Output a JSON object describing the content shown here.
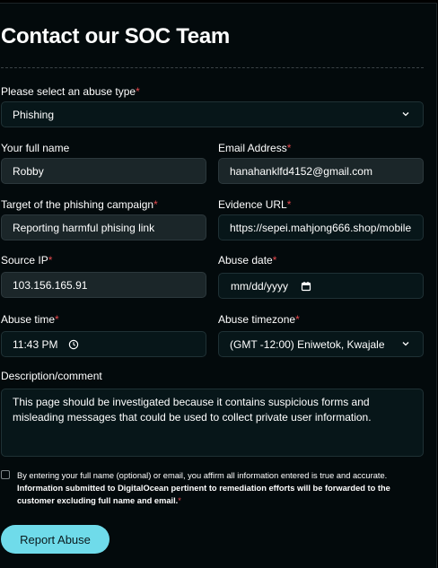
{
  "header": {
    "title": "Contact our SOC Team"
  },
  "form": {
    "abuse_type": {
      "label": "Please select an abuse type",
      "required_mark": "*",
      "value": "Phishing"
    },
    "full_name": {
      "label": "Your full name",
      "value": "Robby"
    },
    "email": {
      "label": "Email Address",
      "required_mark": "*",
      "value": "hanahanklfd4152@gmail.com"
    },
    "target": {
      "label": "Target of the phishing campaign",
      "required_mark": "*",
      "value": "Reporting harmful phising link"
    },
    "evidence_url": {
      "label": "Evidence URL",
      "required_mark": "*",
      "value": "https://sepei.mahjong666.shop/mobile"
    },
    "source_ip": {
      "label": "Source IP",
      "required_mark": "*",
      "value": "103.156.165.91"
    },
    "abuse_date": {
      "label": "Abuse date",
      "required_mark": "*",
      "value": "mm/dd/yyyy"
    },
    "abuse_time": {
      "label": "Abuse time",
      "required_mark": "*",
      "value": "11:43 PM"
    },
    "timezone": {
      "label": "Abuse timezone",
      "required_mark": "*",
      "value": "(GMT -12:00) Eniwetok, Kwajale"
    },
    "description": {
      "label": "Description/comment",
      "value": "This page should be investigated because it contains suspicious forms and misleading messages that could be used to collect private user information."
    },
    "consent": {
      "text_plain": "By entering your full name (optional) or email, you affirm all information entered is true and accurate. ",
      "text_bold": "Information submitted to DigitalOcean pertinent to remediation efforts will be forwarded to the customer excluding full name and email.",
      "required_mark": "*"
    },
    "submit_label": "Report Abuse"
  },
  "icons": {
    "select": "chevron-down-icon",
    "date": "calendar-icon",
    "time": "clock-icon"
  },
  "colors": {
    "background": "#030a0c",
    "field_bg": "#071619",
    "field_filled_bg": "#1b2629",
    "required": "#e5484d",
    "button": "#6fdbea"
  }
}
